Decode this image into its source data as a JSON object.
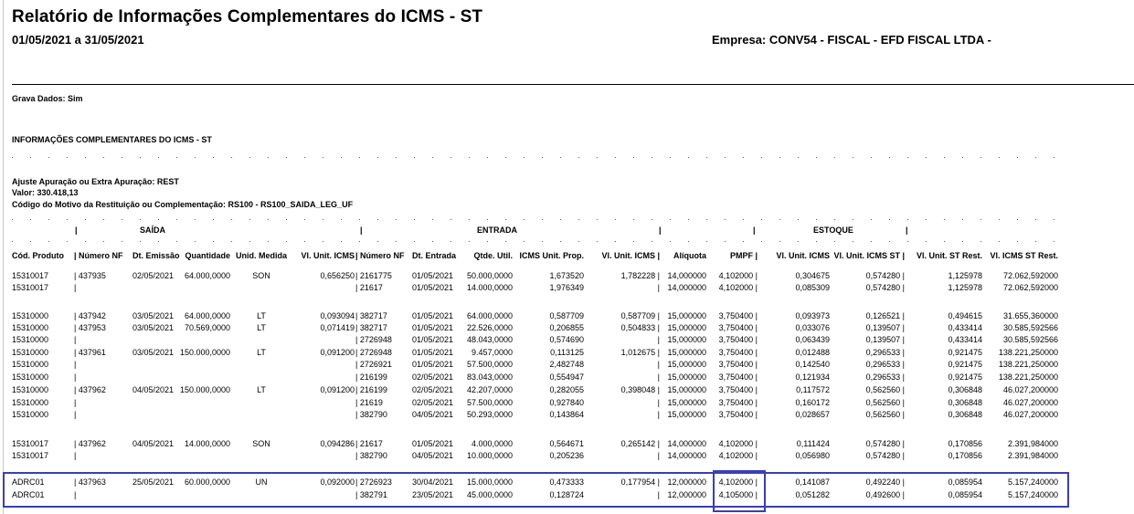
{
  "header": {
    "title": "Relatório de Informações Complementares do ICMS - ST",
    "period": "01/05/2021 a 31/05/2021",
    "empresa": "Empresa: CONV54 - FISCAL - EFD FISCAL LTDA -"
  },
  "grava_dados": "Grava Dados: Sim",
  "section_title": "INFORMAÇÕES COMPLEMENTARES DO ICMS - ST",
  "ajuste": {
    "line1": "Ajuste Apuração ou Extra Apuração: REST",
    "line2": "Valor: 330.418,13",
    "line3": "Código do Motivo da Restituição ou Complementação: RS100 - RS100_SAIDA_LEG_UF"
  },
  "groups": {
    "saida": "SAÍDA",
    "entrada": "ENTRADA",
    "estoque": "ESTOQUE"
  },
  "columns": [
    "Cód. Produto",
    "| Número NF",
    "Dt. Emissão",
    "Quantidade",
    "Unid. Medida",
    "Vl. Unit. ICMS",
    "| Número NF",
    "Dt. Entrada",
    "Qtde. Util.",
    "ICMS Unit. Prop.",
    "Vl. Unit. ICMS |",
    "Alíquota",
    "PMPF |",
    "Vl. Unit. ICMS",
    "Vl. Unit. ICMS ST |",
    "Vl. Unit. ST Rest.",
    "Vl. ICMS ST Rest."
  ],
  "rows": [
    [
      "15310017",
      "| 437935",
      "02/05/2021",
      "64.000,0000",
      "SON",
      "0,656250",
      "| 2161775",
      "01/05/2021",
      "50.000,0000",
      "1,673520",
      "1,782228 |",
      "14,000000",
      "4,102000 |",
      "0,304675",
      "0,574280 |",
      "1,125978",
      "72.062,592000"
    ],
    [
      "15310017",
      "|",
      "",
      "",
      "",
      "",
      "| 21617",
      "01/05/2021",
      "14.000,0000",
      "1,976349",
      "|",
      "14,000000",
      "4,102000 |",
      "0,085309",
      "0,574280 |",
      "1,125978",
      "72.062,592000"
    ],
    [
      "15310000",
      "| 437942",
      "03/05/2021",
      "64.000,0000",
      "LT",
      "0,093094",
      "| 382717",
      "01/05/2021",
      "64.000,0000",
      "0,587709",
      "0,587709 |",
      "15,000000",
      "3,750400 |",
      "0,093973",
      "0,126521 |",
      "0,494615",
      "31.655,360000"
    ],
    [
      "15310000",
      "| 437953",
      "03/05/2021",
      "70.569,0000",
      "LT",
      "0,071419",
      "| 382717",
      "01/05/2021",
      "22.526,0000",
      "0,206855",
      "0,504833 |",
      "15,000000",
      "3,750400 |",
      "0,033076",
      "0,139507 |",
      "0,433414",
      "30.585,592566"
    ],
    [
      "15310000",
      "|",
      "",
      "",
      "",
      "",
      "| 2726948",
      "01/05/2021",
      "48.043,0000",
      "0,574690",
      "|",
      "15,000000",
      "3,750400 |",
      "0,063439",
      "0,139507 |",
      "0,433414",
      "30.585,592566"
    ],
    [
      "15310000",
      "| 437961",
      "03/05/2021",
      "150.000,0000",
      "LT",
      "0,091200",
      "| 2726948",
      "01/05/2021",
      "9.457,0000",
      "0,113125",
      "1,012675 |",
      "15,000000",
      "3,750400 |",
      "0,012488",
      "0,296533 |",
      "0,921475",
      "138.221,250000"
    ],
    [
      "15310000",
      "|",
      "",
      "",
      "",
      "",
      "| 2726921",
      "01/05/2021",
      "57.500,0000",
      "2,482748",
      "|",
      "15,000000",
      "3,750400 |",
      "0,142540",
      "0,296533 |",
      "0,921475",
      "138.221,250000"
    ],
    [
      "15310000",
      "|",
      "",
      "",
      "",
      "",
      "| 216199",
      "02/05/2021",
      "83.043,0000",
      "0,554947",
      "|",
      "15,000000",
      "3,750400 |",
      "0,121934",
      "0,296533 |",
      "0,921475",
      "138.221,250000"
    ],
    [
      "15310000",
      "| 437962",
      "04/05/2021",
      "150.000,0000",
      "LT",
      "0,091200",
      "| 216199",
      "02/05/2021",
      "42.207,0000",
      "0,282055",
      "0,398048 |",
      "15,000000",
      "3,750400 |",
      "0,117572",
      "0,562560 |",
      "0,306848",
      "46.027,200000"
    ],
    [
      "15310000",
      "|",
      "",
      "",
      "",
      "",
      "| 21619",
      "02/05/2021",
      "57.500,0000",
      "0,927840",
      "|",
      "15,000000",
      "3,750400 |",
      "0,160172",
      "0,562560 |",
      "0,306848",
      "46.027,200000"
    ],
    [
      "15310000",
      "|",
      "",
      "",
      "",
      "",
      "| 382790",
      "04/05/2021",
      "50.293,0000",
      "0,143864",
      "|",
      "15,000000",
      "3,750400 |",
      "0,028657",
      "0,562560 |",
      "0,306848",
      "46.027,200000"
    ],
    [
      "15310017",
      "| 437962",
      "04/05/2021",
      "14.000,0000",
      "SON",
      "0,094286",
      "| 21617",
      "01/05/2021",
      "4.000,0000",
      "0,564671",
      "0,265142 |",
      "14,000000",
      "4,102000 |",
      "0,111424",
      "0,574280 |",
      "0,170856",
      "2.391,984000"
    ],
    [
      "15310017",
      "|",
      "",
      "",
      "",
      "",
      "| 382790",
      "04/05/2021",
      "10.000,0000",
      "0,205236",
      "|",
      "14,000000",
      "4,102000 |",
      "0,056980",
      "0,574280 |",
      "0,170856",
      "2.391,984000"
    ],
    [
      "ADRC01",
      "| 437963",
      "25/05/2021",
      "60.000,0000",
      "UN",
      "0,092000",
      "| 2726923",
      "30/04/2021",
      "15.000,0000",
      "0,473333",
      "0,177954 |",
      "12,000000",
      "4,102000 |",
      "0,141087",
      "0,492240 |",
      "0,085954",
      "5.157,240000"
    ],
    [
      "ADRC01",
      "|",
      "",
      "",
      "",
      "",
      "| 382791",
      "23/05/2021",
      "45.000,0000",
      "0,128724",
      "|",
      "12,000000",
      "4,105000 |",
      "0,051282",
      "0,492600 |",
      "0,085954",
      "5.157,240000"
    ]
  ]
}
